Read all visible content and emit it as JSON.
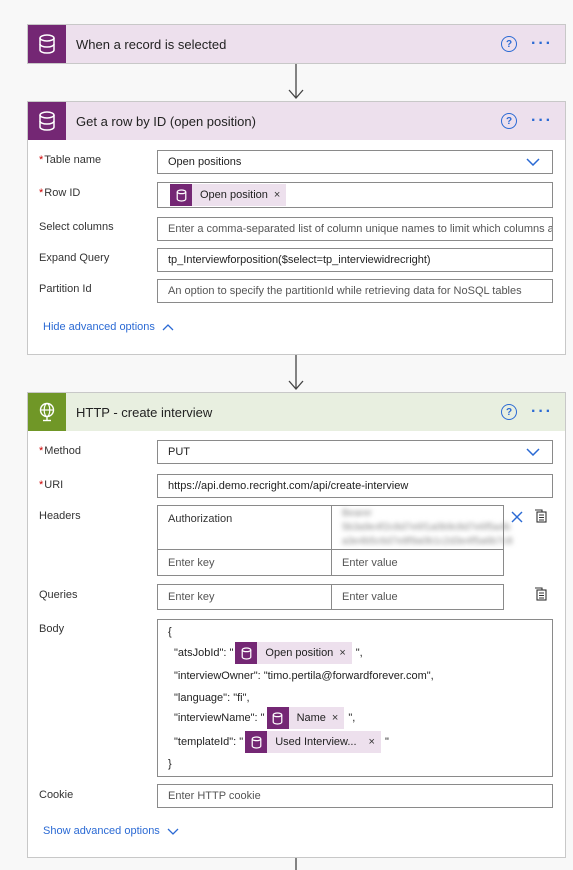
{
  "trigger": {
    "title": "When a record is selected"
  },
  "get_row": {
    "title": "Get a row by ID (open position)",
    "table_name_label": "Table name",
    "table_name_value": "Open positions",
    "row_id_label": "Row ID",
    "row_id_token": "Open position",
    "select_columns_label": "Select columns",
    "select_columns_placeholder": "Enter a comma-separated list of column unique names to limit which columns a",
    "expand_query_label": "Expand Query",
    "expand_query_value": "tp_Interviewforposition($select=tp_interviewidrecright)",
    "partition_label": "Partition Id",
    "partition_placeholder": "An option to specify the partitionId while retrieving data for NoSQL tables",
    "hide_advanced": "Hide advanced options"
  },
  "http": {
    "title": "HTTP - create interview",
    "method_label": "Method",
    "method_value": "PUT",
    "uri_label": "URI",
    "uri_value": "https://api.demo.recright.com/api/create-interview",
    "headers_label": "Headers",
    "header_key": "Authorization",
    "header_value_line1": "Bearer 5b3a9e4f2c8d7e6f1a0b9c8d7e6f5a4b",
    "header_value_line2": "a3e4b5c6d7e8f9a0b1c2d3e4f5a6b7c8",
    "enter_key": "Enter key",
    "enter_value": "Enter value",
    "queries_label": "Queries",
    "body_label": "Body",
    "body": {
      "open_brace": "{",
      "ats_prefix": "\"atsJobId\": \"",
      "ats_token": "Open position",
      "ats_suffix": "\",",
      "owner_line": "\"interviewOwner\": \"timo.pertila@forwardforever.com\",",
      "language_line": "\"language\": \"fi\",",
      "name_prefix": "\"interviewName\": \"",
      "name_token": "Name",
      "name_suffix": "\",",
      "template_prefix": "\"templateId\": \"",
      "template_token": "Used Interview...",
      "template_suffix": "\"",
      "close_brace": "}"
    },
    "cookie_label": "Cookie",
    "cookie_placeholder": "Enter HTTP cookie",
    "show_advanced": "Show advanced options"
  },
  "icons": {
    "dataverse": "database-icon",
    "http": "globe-icon",
    "help": "question-circle-icon",
    "more": "ellipsis-icon",
    "dropdown": "chevron-down-icon"
  },
  "colors": {
    "dataverse_accent": "#742774",
    "http_accent": "#709727",
    "link_blue": "#2b6ad4"
  },
  "help_glyph": "?",
  "more_glyph": "···",
  "required_mark": "*",
  "remove_glyph": "×"
}
